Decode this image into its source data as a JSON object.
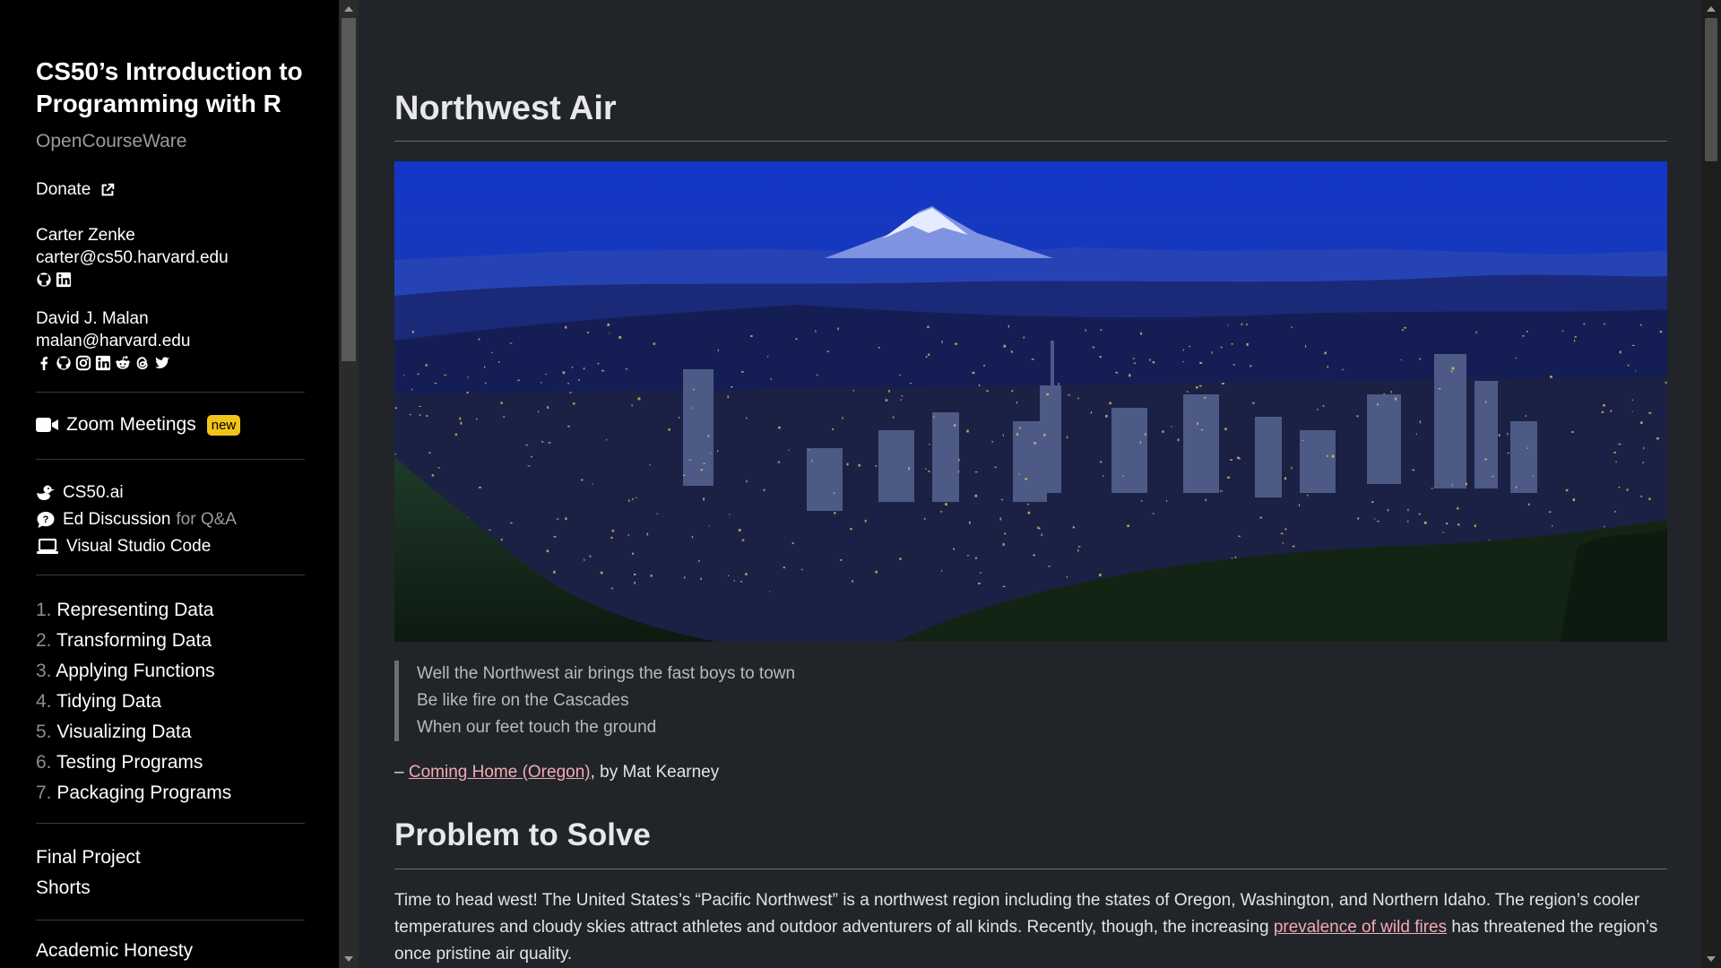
{
  "sidebar": {
    "course_title": "CS50’s Introduction to Programming with R",
    "course_subtitle": "OpenCourseWare",
    "donate_label": "Donate",
    "people": [
      {
        "name": "Carter Zenke",
        "email": "carter@cs50.harvard.edu",
        "icons": [
          "github-icon",
          "linkedin-icon"
        ]
      },
      {
        "name": "David J. Malan",
        "email": "malan@harvard.edu",
        "icons": [
          "facebook-icon",
          "github-icon",
          "instagram-icon",
          "linkedin-icon",
          "reddit-icon",
          "threads-icon",
          "twitter-icon"
        ]
      }
    ],
    "zoom_label": "Zoom Meetings",
    "zoom_badge": "new",
    "tools": [
      {
        "label": "CS50.ai",
        "icon": "duck-icon"
      },
      {
        "label": "Ed Discussion",
        "suffix": "for Q&A",
        "icon": "chat-icon"
      },
      {
        "label": "Visual Studio Code",
        "icon": "laptop-icon"
      }
    ],
    "lectures": [
      {
        "num": "1.",
        "label": "Representing Data"
      },
      {
        "num": "2.",
        "label": "Transforming Data"
      },
      {
        "num": "3.",
        "label": "Applying Functions"
      },
      {
        "num": "4.",
        "label": "Tidying Data"
      },
      {
        "num": "5.",
        "label": "Visualizing Data"
      },
      {
        "num": "6.",
        "label": "Testing Programs"
      },
      {
        "num": "7.",
        "label": "Packaging Programs"
      }
    ],
    "extras": [
      "Final Project",
      "Shorts"
    ],
    "academic_honesty": "Academic Honesty"
  },
  "main": {
    "title": "Northwest Air",
    "quote_lines": [
      "Well the Northwest air brings the fast boys to town",
      "Be like fire on the Cascades",
      "When our feet touch the ground"
    ],
    "attribution": {
      "dash": "–",
      "link_text": "Coming Home (Oregon)",
      "rest": ", by Mat Kearney"
    },
    "section_title": "Problem to Solve",
    "paragraph": {
      "before_link": "Time to head west! The United States’s “Pacific Northwest” is a northwest region including the states of Oregon, Washington, and Northern Idaho. The region’s cooler temperatures and cloudy skies attract athletes and outdoor adventurers of all kinds. Recently, though, the increasing ",
      "link_text": "prevalence of wild fires",
      "after_link": " has threatened the region’s once pristine air quality."
    }
  },
  "colors": {
    "sidebar_bg": "#000000",
    "page_bg": "#212529",
    "link": "#f4a9b8",
    "badge": "#f0c419"
  }
}
